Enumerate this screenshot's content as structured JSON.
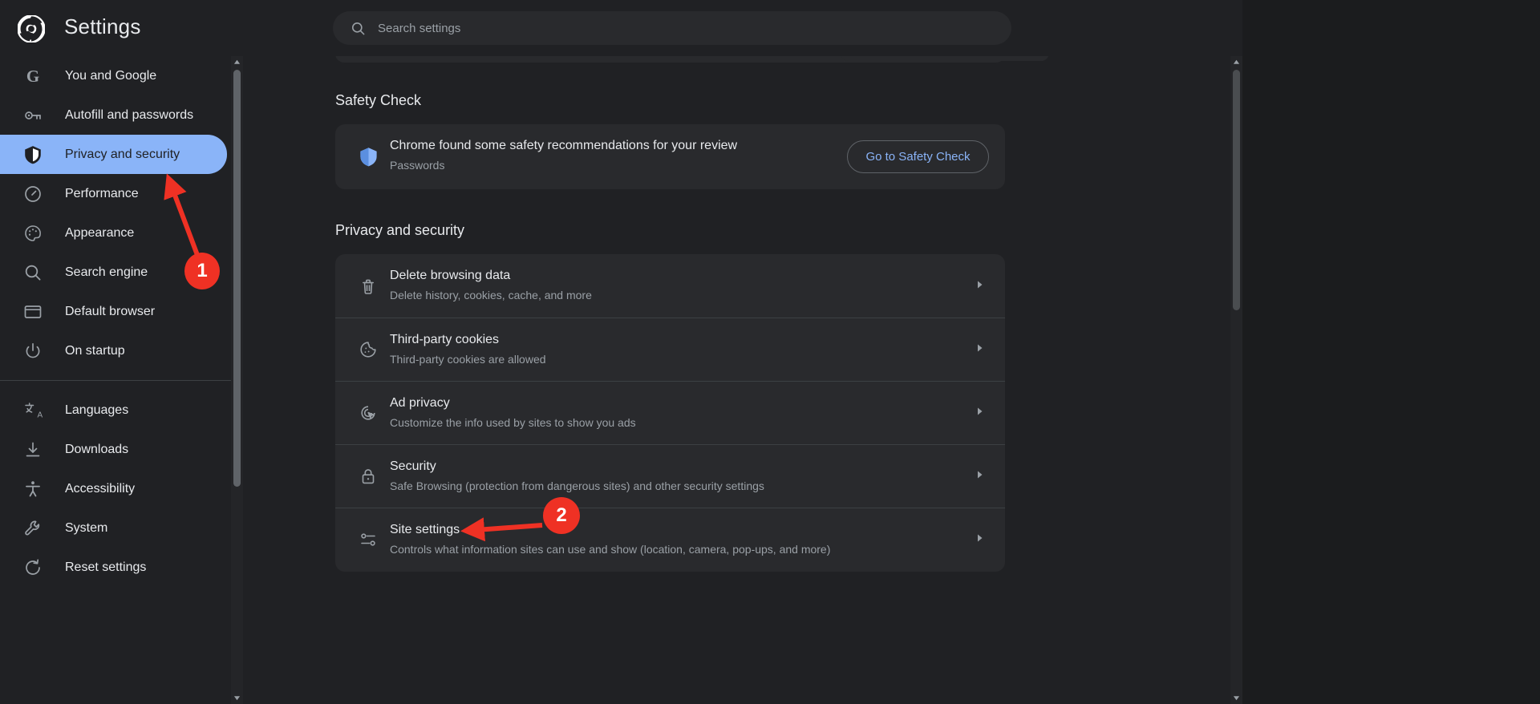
{
  "app": {
    "title": "Settings",
    "logo_icon": "chrome-logo-icon"
  },
  "search": {
    "placeholder": "Search settings",
    "value": "",
    "icon": "search-icon"
  },
  "sidebar": {
    "items": [
      {
        "label": "You and Google",
        "icon": "google-g-icon",
        "active": false
      },
      {
        "label": "Autofill and passwords",
        "icon": "key-icon",
        "active": false
      },
      {
        "label": "Privacy and security",
        "icon": "shield-icon",
        "active": true
      },
      {
        "label": "Performance",
        "icon": "speedometer-icon",
        "active": false
      },
      {
        "label": "Appearance",
        "icon": "palette-icon",
        "active": false
      },
      {
        "label": "Search engine",
        "icon": "magnifier-icon",
        "active": false
      },
      {
        "label": "Default browser",
        "icon": "browser-window-icon",
        "active": false
      },
      {
        "label": "On startup",
        "icon": "power-icon",
        "active": false
      }
    ],
    "items2": [
      {
        "label": "Languages",
        "icon": "translate-icon",
        "active": false
      },
      {
        "label": "Downloads",
        "icon": "download-icon",
        "active": false
      },
      {
        "label": "Accessibility",
        "icon": "accessibility-icon",
        "active": false
      },
      {
        "label": "System",
        "icon": "wrench-icon",
        "active": false
      },
      {
        "label": "Reset settings",
        "icon": "reset-icon",
        "active": false
      }
    ]
  },
  "main": {
    "safety_check": {
      "heading": "Safety Check",
      "icon": "shield-blue-icon",
      "title": "Chrome found some safety recommendations for your review",
      "subtitle": "Passwords",
      "button_label": "Go to Safety Check"
    },
    "privacy": {
      "heading": "Privacy and security",
      "rows": [
        {
          "title": "Delete browsing data",
          "subtitle": "Delete history, cookies, cache, and more",
          "icon": "trash-icon"
        },
        {
          "title": "Third-party cookies",
          "subtitle": "Third-party cookies are allowed",
          "icon": "cookie-icon"
        },
        {
          "title": "Ad privacy",
          "subtitle": "Customize the info used by sites to show you ads",
          "icon": "ad-target-icon"
        },
        {
          "title": "Security",
          "subtitle": "Safe Browsing (protection from dangerous sites) and other security settings",
          "icon": "lock-icon"
        },
        {
          "title": "Site settings",
          "subtitle": "Controls what information sites can use and show (location, camera, pop-ups, and more)",
          "icon": "sliders-icon"
        }
      ]
    }
  },
  "annotations": [
    {
      "label": "1",
      "target": "Privacy and security sidebar item"
    },
    {
      "label": "2",
      "target": "Site settings row"
    }
  ],
  "colors": {
    "background": "#202124",
    "card": "#292a2d",
    "accent_blue": "#8ab4f8",
    "annotation_red": "#ef3124",
    "text_primary": "#e8eaed",
    "text_secondary": "#9aa0a6"
  }
}
